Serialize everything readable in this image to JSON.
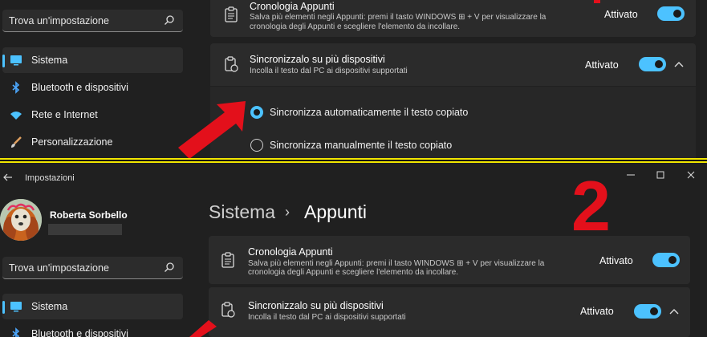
{
  "top": {
    "search": {
      "placeholder": "Trova un'impostazione"
    },
    "nav": [
      {
        "label": "Sistema",
        "icon": "monitor-icon"
      },
      {
        "label": "Bluetooth e dispositivi",
        "icon": "bluetooth-icon"
      },
      {
        "label": "Rete e Internet",
        "icon": "wifi-icon"
      },
      {
        "label": "Personalizzazione",
        "icon": "brush-icon"
      }
    ],
    "history": {
      "title": "Cronologia Appunti",
      "desc1": "Salva più elementi negli Appunti: premi il tasto WINDOWS ⊞ + V per visualizzare la",
      "desc2": "cronologia degli Appunti e scegliere l'elemento da incollare.",
      "state": "Attivato"
    },
    "sync": {
      "title": "Sincronizzalo su più dispositivi",
      "desc": "Incolla il testo dal PC ai dispositivi supportati",
      "state": "Attivato"
    },
    "options": [
      {
        "label": "Sincronizza automaticamente il testo copiato",
        "selected": true
      },
      {
        "label": "Sincronizza manualmente il testo copiato",
        "selected": false
      }
    ]
  },
  "bottom": {
    "app_title": "Impostazioni",
    "user_name": "Roberta Sorbello",
    "search": {
      "placeholder": "Trova un'impostazione"
    },
    "breadcrumb": {
      "parent": "Sistema",
      "separator": "›",
      "current": "Appunti"
    },
    "annotation_number": "2",
    "nav": [
      {
        "label": "Sistema",
        "icon": "monitor-icon"
      },
      {
        "label": "Bluetooth e dispositivi",
        "icon": "bluetooth-icon"
      }
    ],
    "history": {
      "title": "Cronologia Appunti",
      "desc1": "Salva più elementi negli Appunti: premi il tasto WINDOWS ⊞ + V per visualizzare la",
      "desc2": "cronologia degli Appunti e scegliere l'elemento da incollare.",
      "state": "Attivato"
    },
    "sync": {
      "title": "Sincronizzalo su più dispositivi",
      "desc": "Incolla il testo dal PC ai dispositivi supportati",
      "state": "Attivato"
    }
  },
  "colors": {
    "accent": "#4cc2ff",
    "annotation": "#e3101b",
    "divider": "#f2e700"
  }
}
